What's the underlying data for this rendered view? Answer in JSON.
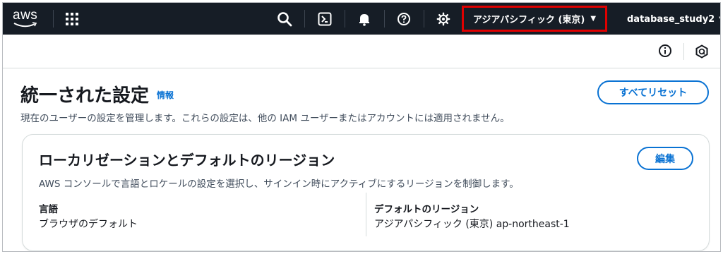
{
  "topnav": {
    "logo_text": "aws",
    "region_label": "アジアパシフィック (東京)",
    "account_label": "database_study2",
    "icons": [
      "search-icon",
      "cloudshell-icon",
      "bell-icon",
      "help-icon",
      "gear-icon"
    ]
  },
  "page": {
    "title": "統一された設定",
    "info_link": "情報",
    "reset_button": "すべてリセット",
    "description": "現在のユーザーの設定を管理します。これらの設定は、他の IAM ユーザーまたはアカウントには適用されません。"
  },
  "card": {
    "title": "ローカリゼーションとデフォルトのリージョン",
    "edit_button": "編集",
    "description": "AWS コンソールで言語とロケールの設定を選択し、サインイン時にアクティブにするリージョンを制御します。",
    "language_label": "言語",
    "language_value": "ブラウザのデフォルト",
    "region_label": "デフォルトのリージョン",
    "region_value": "アジアパシフィック (東京) ap-northeast-1"
  },
  "colors": {
    "nav_bg": "#161d26",
    "accent": "#0972d3",
    "highlight": "#e00000"
  }
}
